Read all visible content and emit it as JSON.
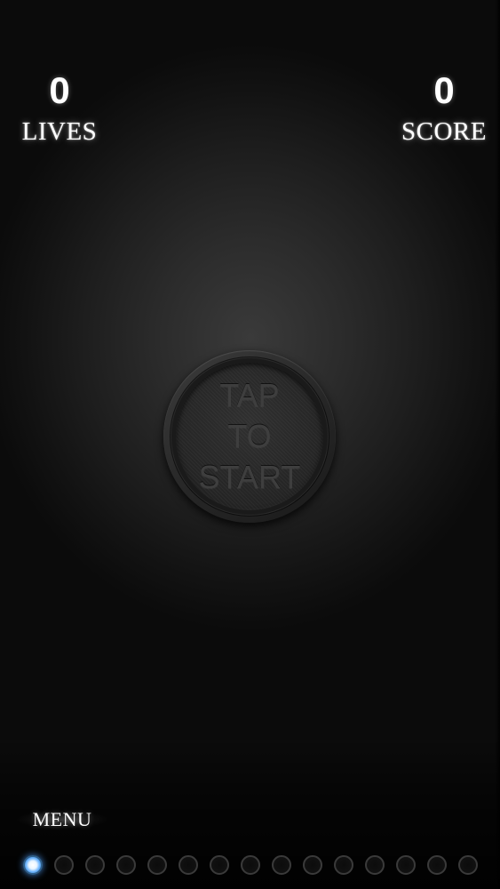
{
  "hud": {
    "lives": {
      "value": "0",
      "label": "LIVES"
    },
    "score": {
      "value": "0",
      "label": "SCORE"
    }
  },
  "start_button": {
    "lines": [
      "TAP",
      "TO",
      "START"
    ]
  },
  "menu": {
    "label": "MENU"
  },
  "level_indicator": {
    "total": 15,
    "active_index": 0,
    "active_color": "#6fb6ff"
  },
  "colors": {
    "background": "#2b2b2b",
    "text": "#ffffff",
    "button_text": "#3e3e3e"
  }
}
